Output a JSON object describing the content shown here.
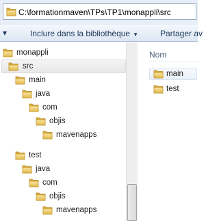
{
  "address_bar": {
    "path": "C:\\formationmaven\\TPs\\TP1\\monappli\\src"
  },
  "toolbar": {
    "include_library_label": "Inclure dans la bibliothèque",
    "share_label": "Partager av"
  },
  "tree": {
    "items": [
      {
        "label": "monappli"
      },
      {
        "label": "src"
      },
      {
        "label": "main"
      },
      {
        "label": "java"
      },
      {
        "label": "com"
      },
      {
        "label": "objis"
      },
      {
        "label": "mavenapps"
      },
      {
        "label": "test"
      },
      {
        "label": "java"
      },
      {
        "label": "com"
      },
      {
        "label": "objis"
      },
      {
        "label": "mavenapps"
      }
    ],
    "selected_index": 1
  },
  "content": {
    "column_header": "Nom",
    "items": [
      {
        "label": "main"
      },
      {
        "label": "test"
      }
    ]
  },
  "colors": {
    "folder": "#e7c25c",
    "toolbar_text": "#1e395b",
    "address_bg": "#e7eef7"
  },
  "icons": {
    "folder": "folder-icon",
    "dropdown": "chevron-down-icon"
  }
}
